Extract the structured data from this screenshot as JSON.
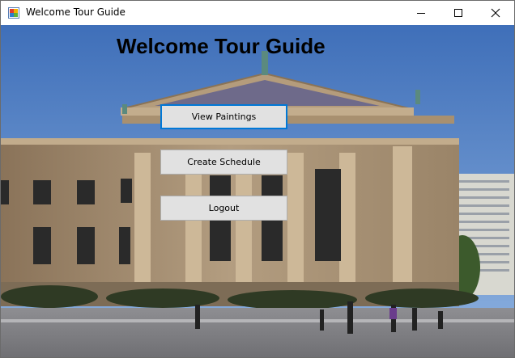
{
  "window": {
    "title": "Welcome Tour Guide",
    "icon": "winforms-app-icon",
    "controls": [
      "minimize-icon",
      "maximize-icon",
      "close-icon"
    ]
  },
  "main": {
    "heading": "Welcome Tour Guide",
    "background": "museum-building-photo",
    "buttons": {
      "view_paintings": "View Paintings",
      "create_schedule": "Create Schedule",
      "logout": "Logout"
    },
    "focused_button": "View Paintings"
  },
  "colors": {
    "focus_border": "#0078d7",
    "button_face": "#e1e1e1",
    "button_border": "#adadad",
    "sky": "#5b88c9",
    "stone": "#a58d6e"
  }
}
